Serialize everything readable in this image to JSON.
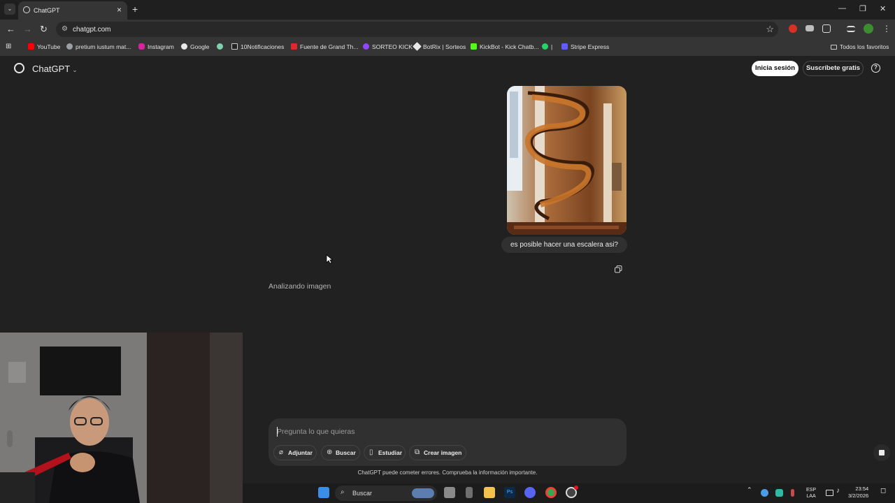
{
  "browser": {
    "tab_title": "ChatGPT",
    "url": "chatgpt.com",
    "bookmarks": [
      {
        "label": "YouTube",
        "color": "#ff0000"
      },
      {
        "label": "pretium iustum mat...",
        "color": "#9aa0a6"
      },
      {
        "label": "Instagram",
        "color": "#d6249f"
      },
      {
        "label": "Google",
        "color": "#e8e8e8"
      },
      {
        "label": "",
        "color": "#7fd1ae"
      },
      {
        "label": "10Notificaciones",
        "color": "#e8e8e8"
      },
      {
        "label": "Fuente de Grand Th...",
        "color": "#e3262d"
      },
      {
        "label": "SORTEO KICK",
        "color": "#9146ff"
      },
      {
        "label": "BotRix | Sorteos",
        "color": "#e8e8e8"
      },
      {
        "label": "KickBot - Kick Chatb...",
        "color": "#53fc18"
      },
      {
        "label": "|",
        "color": "#25d366"
      },
      {
        "label": "Stripe Express",
        "color": "#635bff"
      }
    ],
    "all_bookmarks": "Todos los favoritos"
  },
  "app": {
    "title": "ChatGPT",
    "login_label": "Inicia sesión",
    "subscribe_label": "Suscríbete gratis",
    "help_glyph": "?"
  },
  "chat": {
    "user_message": "es posible hacer una escalera asi?",
    "assistant_status": "Analizando imagen"
  },
  "composer": {
    "placeholder": "Pregunta lo que quieras",
    "value": "",
    "tools": [
      {
        "label": "Adjuntar",
        "icon": "paperclip-icon"
      },
      {
        "label": "Buscar",
        "icon": "globe-icon"
      },
      {
        "label": "Estudiar",
        "icon": "book-icon"
      },
      {
        "label": "Crear imagen",
        "icon": "image-icon"
      }
    ]
  },
  "disclaimer": "ChatGPT puede cometer errores. Comprueba la información importante.",
  "taskbar": {
    "search_label": "Buscar",
    "language": "ESP",
    "layout": "LAA",
    "time": "23:54",
    "date": "3/2/2026"
  }
}
